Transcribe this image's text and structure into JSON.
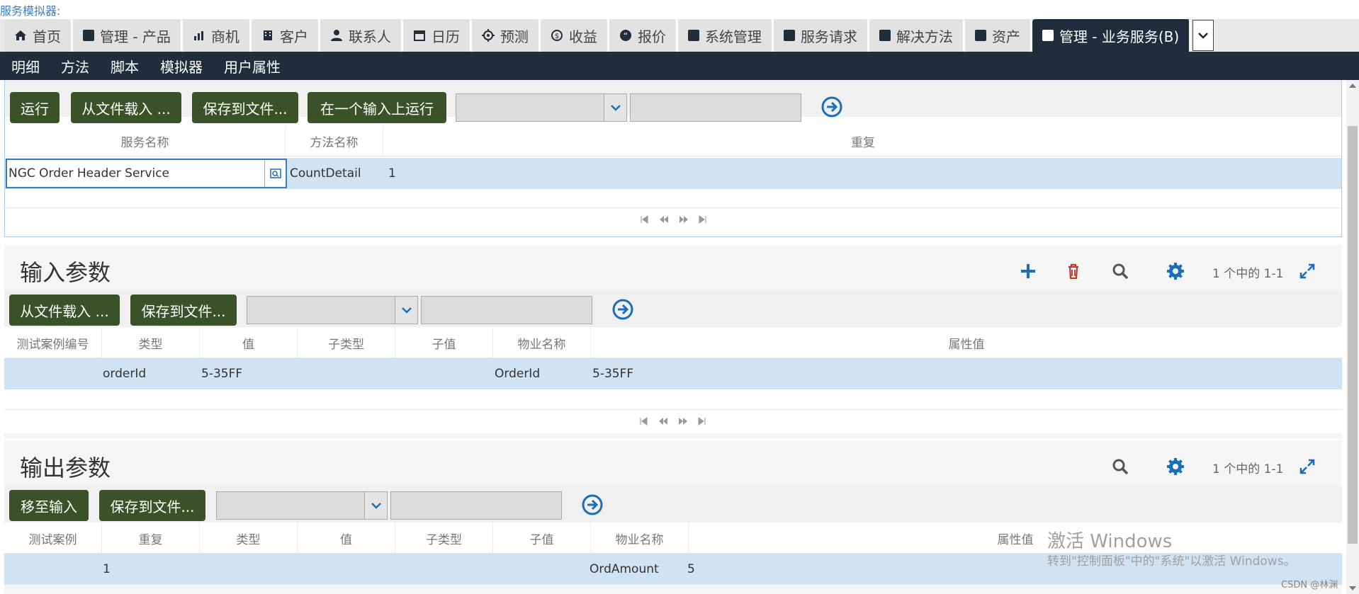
{
  "app": {
    "title": "服务模拟器:"
  },
  "tabs": [
    {
      "label": "首页",
      "icon": "home-icon"
    },
    {
      "label": "管理 - 产品",
      "icon": "square-icon"
    },
    {
      "label": "商机",
      "icon": "chart-icon"
    },
    {
      "label": "客户",
      "icon": "building-icon"
    },
    {
      "label": "联系人",
      "icon": "person-icon"
    },
    {
      "label": "日历",
      "icon": "calendar-icon"
    },
    {
      "label": "预测",
      "icon": "target-icon"
    },
    {
      "label": "收益",
      "icon": "dollar-icon"
    },
    {
      "label": "报价",
      "icon": "quote-icon"
    },
    {
      "label": "系统管理",
      "icon": "square-icon"
    },
    {
      "label": "服务请求",
      "icon": "square-icon"
    },
    {
      "label": "解决方法",
      "icon": "square-icon"
    },
    {
      "label": "资产",
      "icon": "square-icon"
    },
    {
      "label": "管理 - 业务服务(B)",
      "icon": "square-icon",
      "active": true
    }
  ],
  "subnav": [
    "明细",
    "方法",
    "脚本",
    "模拟器",
    "用户属性"
  ],
  "subnav_active": "模拟器",
  "simulator": {
    "buttons": {
      "run": "运行",
      "load": "从文件载入 ...",
      "save": "保存到文件...",
      "run_one": "在一个输入上运行"
    },
    "columns": {
      "service": "服务名称",
      "method": "方法名称",
      "repeat": "重复"
    },
    "row": {
      "service": "NGC Order Header Service",
      "method": "CountDetail",
      "repeat": "1"
    }
  },
  "inputs": {
    "title": "输入参数",
    "count": "1 个中的 1-1",
    "buttons": {
      "load": "从文件载入 ...",
      "save": "保存到文件..."
    },
    "columns": {
      "case": "测试案例编号",
      "type": "类型",
      "value": "值",
      "subtype": "子类型",
      "subvalue": "子值",
      "prop": "物业名称",
      "propval": "属性值"
    },
    "row": {
      "case": "",
      "type": "orderId",
      "value": "5-35FF",
      "subtype": "",
      "subvalue": "",
      "prop": "OrderId",
      "propval": "5-35FF"
    }
  },
  "outputs": {
    "title": "输出参数",
    "count": "1 个中的 1-1",
    "buttons": {
      "move": "移至输入",
      "save": "保存到文件..."
    },
    "columns": {
      "case": "测试案例",
      "repeat": "重复",
      "type": "类型",
      "value": "值",
      "subtype": "子类型",
      "subvalue": "子值",
      "prop": "物业名称",
      "propval": "属性值"
    },
    "row": {
      "case": "",
      "repeat": "1",
      "type": "",
      "value": "",
      "subtype": "",
      "subvalue": "",
      "prop": "OrdAmount",
      "propval": "5"
    }
  },
  "watermark": {
    "line1": "激活 Windows",
    "line2": "转到\"控制面板\"中的\"系统\"以激活 Windows。"
  },
  "footer": {
    "csdn": "CSDN @林渊"
  },
  "colors": {
    "nav": "#1f2d3d",
    "button": "#3a5228",
    "row_selected": "#cfe3f2",
    "icon_blue": "#1a6fb8",
    "icon_red": "#c0392b"
  }
}
